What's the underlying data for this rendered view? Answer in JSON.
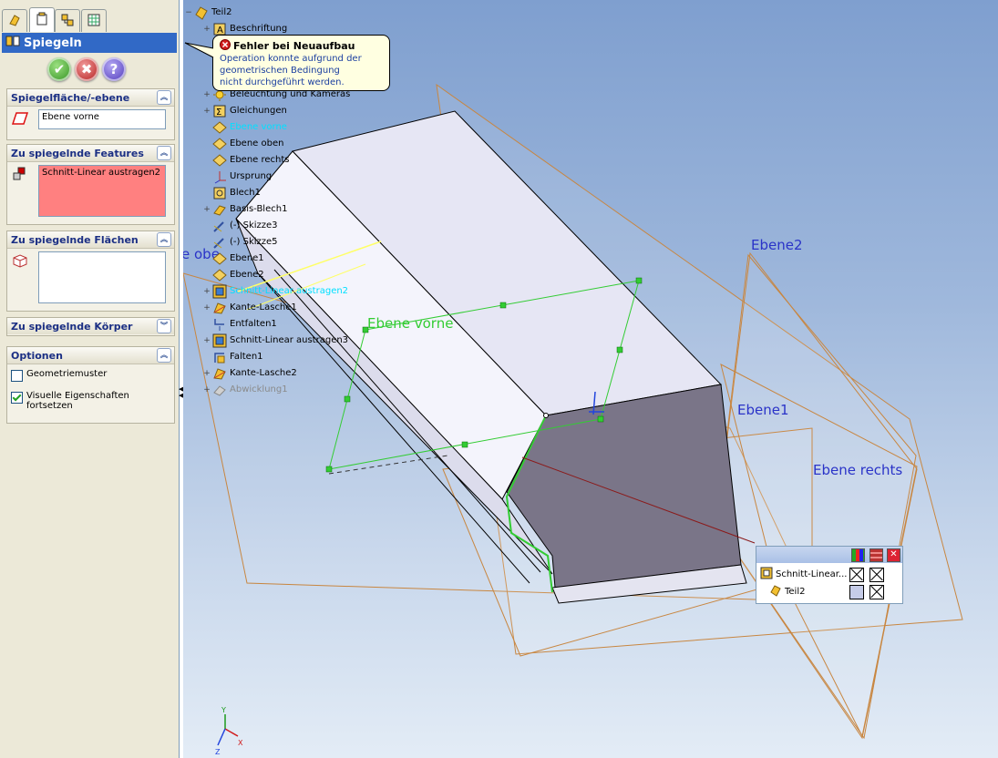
{
  "property_manager": {
    "title": "Spiegeln",
    "groups": {
      "plane": {
        "label": "Spiegelfläche/-ebene",
        "value": "Ebene vorne"
      },
      "features": {
        "label": "Zu spiegelnde Features",
        "value": "Schnitt-Linear austragen2"
      },
      "faces": {
        "label": "Zu spiegelnde Flächen",
        "value": ""
      },
      "bodies": {
        "label": "Zu spiegelnde Körper"
      },
      "options": {
        "label": "Optionen",
        "geometry_pattern": "Geometriemuster",
        "propagate_visual": "Visuelle Eigenschaften fortsetzen",
        "geometry_pattern_checked": false,
        "propagate_visual_checked": true
      }
    }
  },
  "tree": {
    "items": [
      {
        "label": "Teil2",
        "expander": "−",
        "icon": "part-icon"
      },
      {
        "label": "Beschriftung",
        "expander": "+",
        "icon": "annotation-icon"
      },
      {
        "label": "Beleuchtung und Kameras",
        "expander": "+",
        "icon": "lights-icon"
      },
      {
        "label": "Gleichungen",
        "expander": "+",
        "icon": "equations-icon"
      },
      {
        "label": "Ebene vorne",
        "expander": "",
        "icon": "plane-icon",
        "selected": true
      },
      {
        "label": "Ebene oben",
        "expander": "",
        "icon": "plane-icon"
      },
      {
        "label": "Ebene rechts",
        "expander": "",
        "icon": "plane-icon"
      },
      {
        "label": "Ursprung",
        "expander": "",
        "icon": "origin-icon"
      },
      {
        "label": "Blech1",
        "expander": "",
        "icon": "sheetmetal-icon"
      },
      {
        "label": "Basis-Blech1",
        "expander": "+",
        "icon": "base-flange-icon"
      },
      {
        "label": "(-) Skizze3",
        "expander": "",
        "icon": "sketch-icon"
      },
      {
        "label": "(-) Skizze5",
        "expander": "",
        "icon": "sketch-icon"
      },
      {
        "label": "Ebene1",
        "expander": "",
        "icon": "plane-icon"
      },
      {
        "label": "Ebene2",
        "expander": "",
        "icon": "plane-icon"
      },
      {
        "label": "Schnitt-Linear austragen2",
        "expander": "+",
        "icon": "cut-extrude-icon",
        "selected": true
      },
      {
        "label": "Kante-Lasche1",
        "expander": "+",
        "icon": "edge-flange-icon"
      },
      {
        "label": "Entfalten1",
        "expander": "",
        "icon": "unfold-icon"
      },
      {
        "label": "Schnitt-Linear austragen3",
        "expander": "+",
        "icon": "cut-extrude-icon"
      },
      {
        "label": "Falten1",
        "expander": "",
        "icon": "fold-icon"
      },
      {
        "label": "Kante-Lasche2",
        "expander": "+",
        "icon": "edge-flange-icon"
      },
      {
        "label": "Abwicklung1",
        "expander": "+",
        "icon": "flat-pattern-icon",
        "dimmed": true
      }
    ]
  },
  "tooltip": {
    "title": "Fehler bei Neuaufbau",
    "body": "Operation konnte aufgrund der\ngeometrischen Bedingung\nnicht durchgeführt werden."
  },
  "plane_labels": {
    "ebene2": "Ebene2",
    "ebene1": "Ebene1",
    "ebene_rechts": "Ebene rechts",
    "ebene_vorne": "Ebene vorne",
    "ebene_oben_partial": "e obe"
  },
  "popup": {
    "rows": [
      {
        "label": "Schnitt-Linear..."
      },
      {
        "label": "Teil2"
      }
    ]
  }
}
